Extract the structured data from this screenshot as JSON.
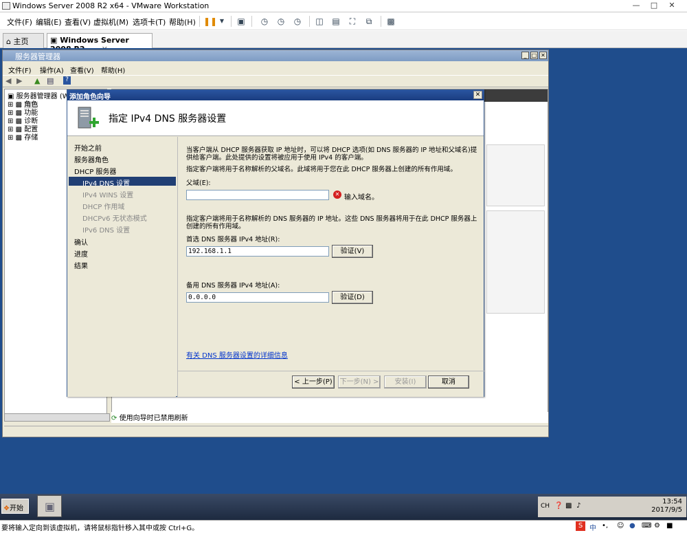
{
  "window": {
    "title": "Windows Server 2008 R2 x64 - VMware Workstation"
  },
  "vmware_menu": {
    "items": [
      "文件(F)",
      "编辑(E)",
      "查看(V)",
      "虚拟机(M)",
      "选项卡(T)",
      "帮助(H)"
    ]
  },
  "tabs": [
    {
      "label": "主页"
    },
    {
      "label": "Windows Server 2008 R2 ..."
    }
  ],
  "server_manager": {
    "title": "服务器管理器",
    "menu": [
      "文件(F)",
      "操作(A)",
      "查看(V)",
      "帮助(H)"
    ],
    "tree": [
      "服务器管理器 (W",
      "角色",
      "功能",
      "诊断",
      "配置",
      "存储"
    ],
    "status": "使用向导时已禁用刷新"
  },
  "wizard": {
    "title": "添加角色向导",
    "heading": "指定 IPv4 DNS 服务器设置",
    "nav": [
      {
        "label": "开始之前",
        "level": 0
      },
      {
        "label": "服务器角色",
        "level": 0
      },
      {
        "label": "DHCP 服务器",
        "level": 0
      },
      {
        "label": "IPv4 DNS 设置",
        "level": 1,
        "current": true
      },
      {
        "label": "IPv4 WINS 设置",
        "level": 1
      },
      {
        "label": "DHCP 作用域",
        "level": 1
      },
      {
        "label": "DHCPv6 无状态模式",
        "level": 1
      },
      {
        "label": "IPv6 DNS 设置",
        "level": 1
      },
      {
        "label": "确认",
        "level": 0
      },
      {
        "label": "进度",
        "level": 0
      },
      {
        "label": "结果",
        "level": 0
      }
    ],
    "intro": "当客户端从 DHCP 服务器获取 IP 地址时，可以将 DHCP 选项(如 DNS 服务器的 IP 地址和父域名)提供给客户端。此处提供的设置将被应用于使用 IPv4 的客户端。",
    "parent_domain_desc": "指定客户端将用于名称解析的父域名。此域将用于您在此 DHCP 服务器上创建的所有作用域。",
    "parent_domain_label": "父域(E):",
    "parent_domain_value": "",
    "parent_domain_error": "输入域名。",
    "dns_desc": "指定客户端将用于名称解析的 DNS 服务器的 IP 地址。这些 DNS 服务器将用于在此 DHCP 服务器上创建的所有作用域。",
    "preferred_label": "首选 DNS 服务器 IPv4 地址(R):",
    "preferred_value": "192.168.1.1",
    "alternate_label": "备用 DNS 服务器 IPv4 地址(A):",
    "alternate_value": "0.0.0.0",
    "validate_label_1": "验证(V)",
    "validate_label_2": "验证(D)",
    "more_info_link": "有关 DNS 服务器设置的详细信息",
    "buttons": {
      "back": "< 上一步(P)",
      "next": "下一步(N) >",
      "install": "安装(I)",
      "cancel": "取消"
    }
  },
  "taskbar": {
    "start": "开始",
    "lang": "CH",
    "time": "13:54",
    "date": "2017/9/5"
  },
  "host_status": "要将输入定向到该虚拟机，请将鼠标指针移入其中或按 Ctrl+G。"
}
